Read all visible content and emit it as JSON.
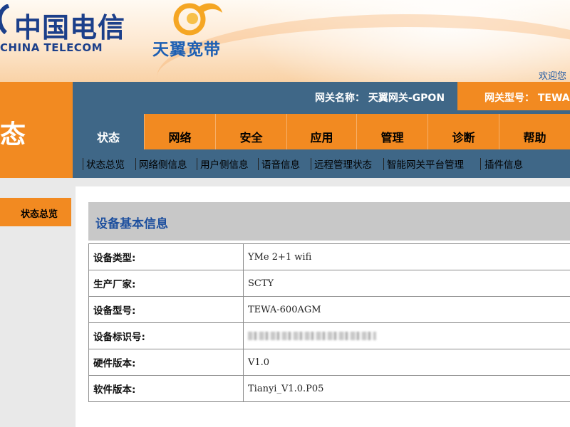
{
  "header": {
    "brand_cn": "中国电信",
    "brand_en": "CHINA TELECOM",
    "product_name": "天翼宽带",
    "welcome_text": "欢迎您",
    "gateway_name": "网关名称： 天翼网关-GPON",
    "gateway_model": "网关型号： TEWA-"
  },
  "page_title": "态",
  "nav": {
    "tabs": [
      {
        "label": "状态",
        "active": true
      },
      {
        "label": "网络",
        "active": false
      },
      {
        "label": "安全",
        "active": false
      },
      {
        "label": "应用",
        "active": false
      },
      {
        "label": "管理",
        "active": false
      },
      {
        "label": "诊断",
        "active": false
      },
      {
        "label": "帮助",
        "active": false
      }
    ],
    "subitems": [
      "状态总览",
      "网络侧信息",
      "用户侧信息",
      "语音信息",
      "远程管理状态",
      "智能网关平台管理",
      "插件信息"
    ]
  },
  "sidebar": {
    "items": [
      {
        "label": "状态总览"
      }
    ]
  },
  "content": {
    "section_title": "设备基本信息",
    "rows": [
      {
        "label": "设备类型:",
        "value": "YMe 2+1 wifi"
      },
      {
        "label": "生产厂家:",
        "value": "SCTY"
      },
      {
        "label": "设备型号:",
        "value": "TEWA-600AGM"
      },
      {
        "label": "设备标识号:",
        "value": ""
      },
      {
        "label": "硬件版本:",
        "value": "V1.0"
      },
      {
        "label": "软件版本:",
        "value": "Tianyi_V1.0.P05"
      }
    ]
  },
  "colors": {
    "orange": "#f28a21",
    "slate_blue": "#3f6787",
    "brand_blue": "#1c3f8a"
  },
  "icons": {
    "china_telecom_logo": "china-telecom-logo-icon",
    "tianyi_logo": "tianyi-logo-icon"
  }
}
